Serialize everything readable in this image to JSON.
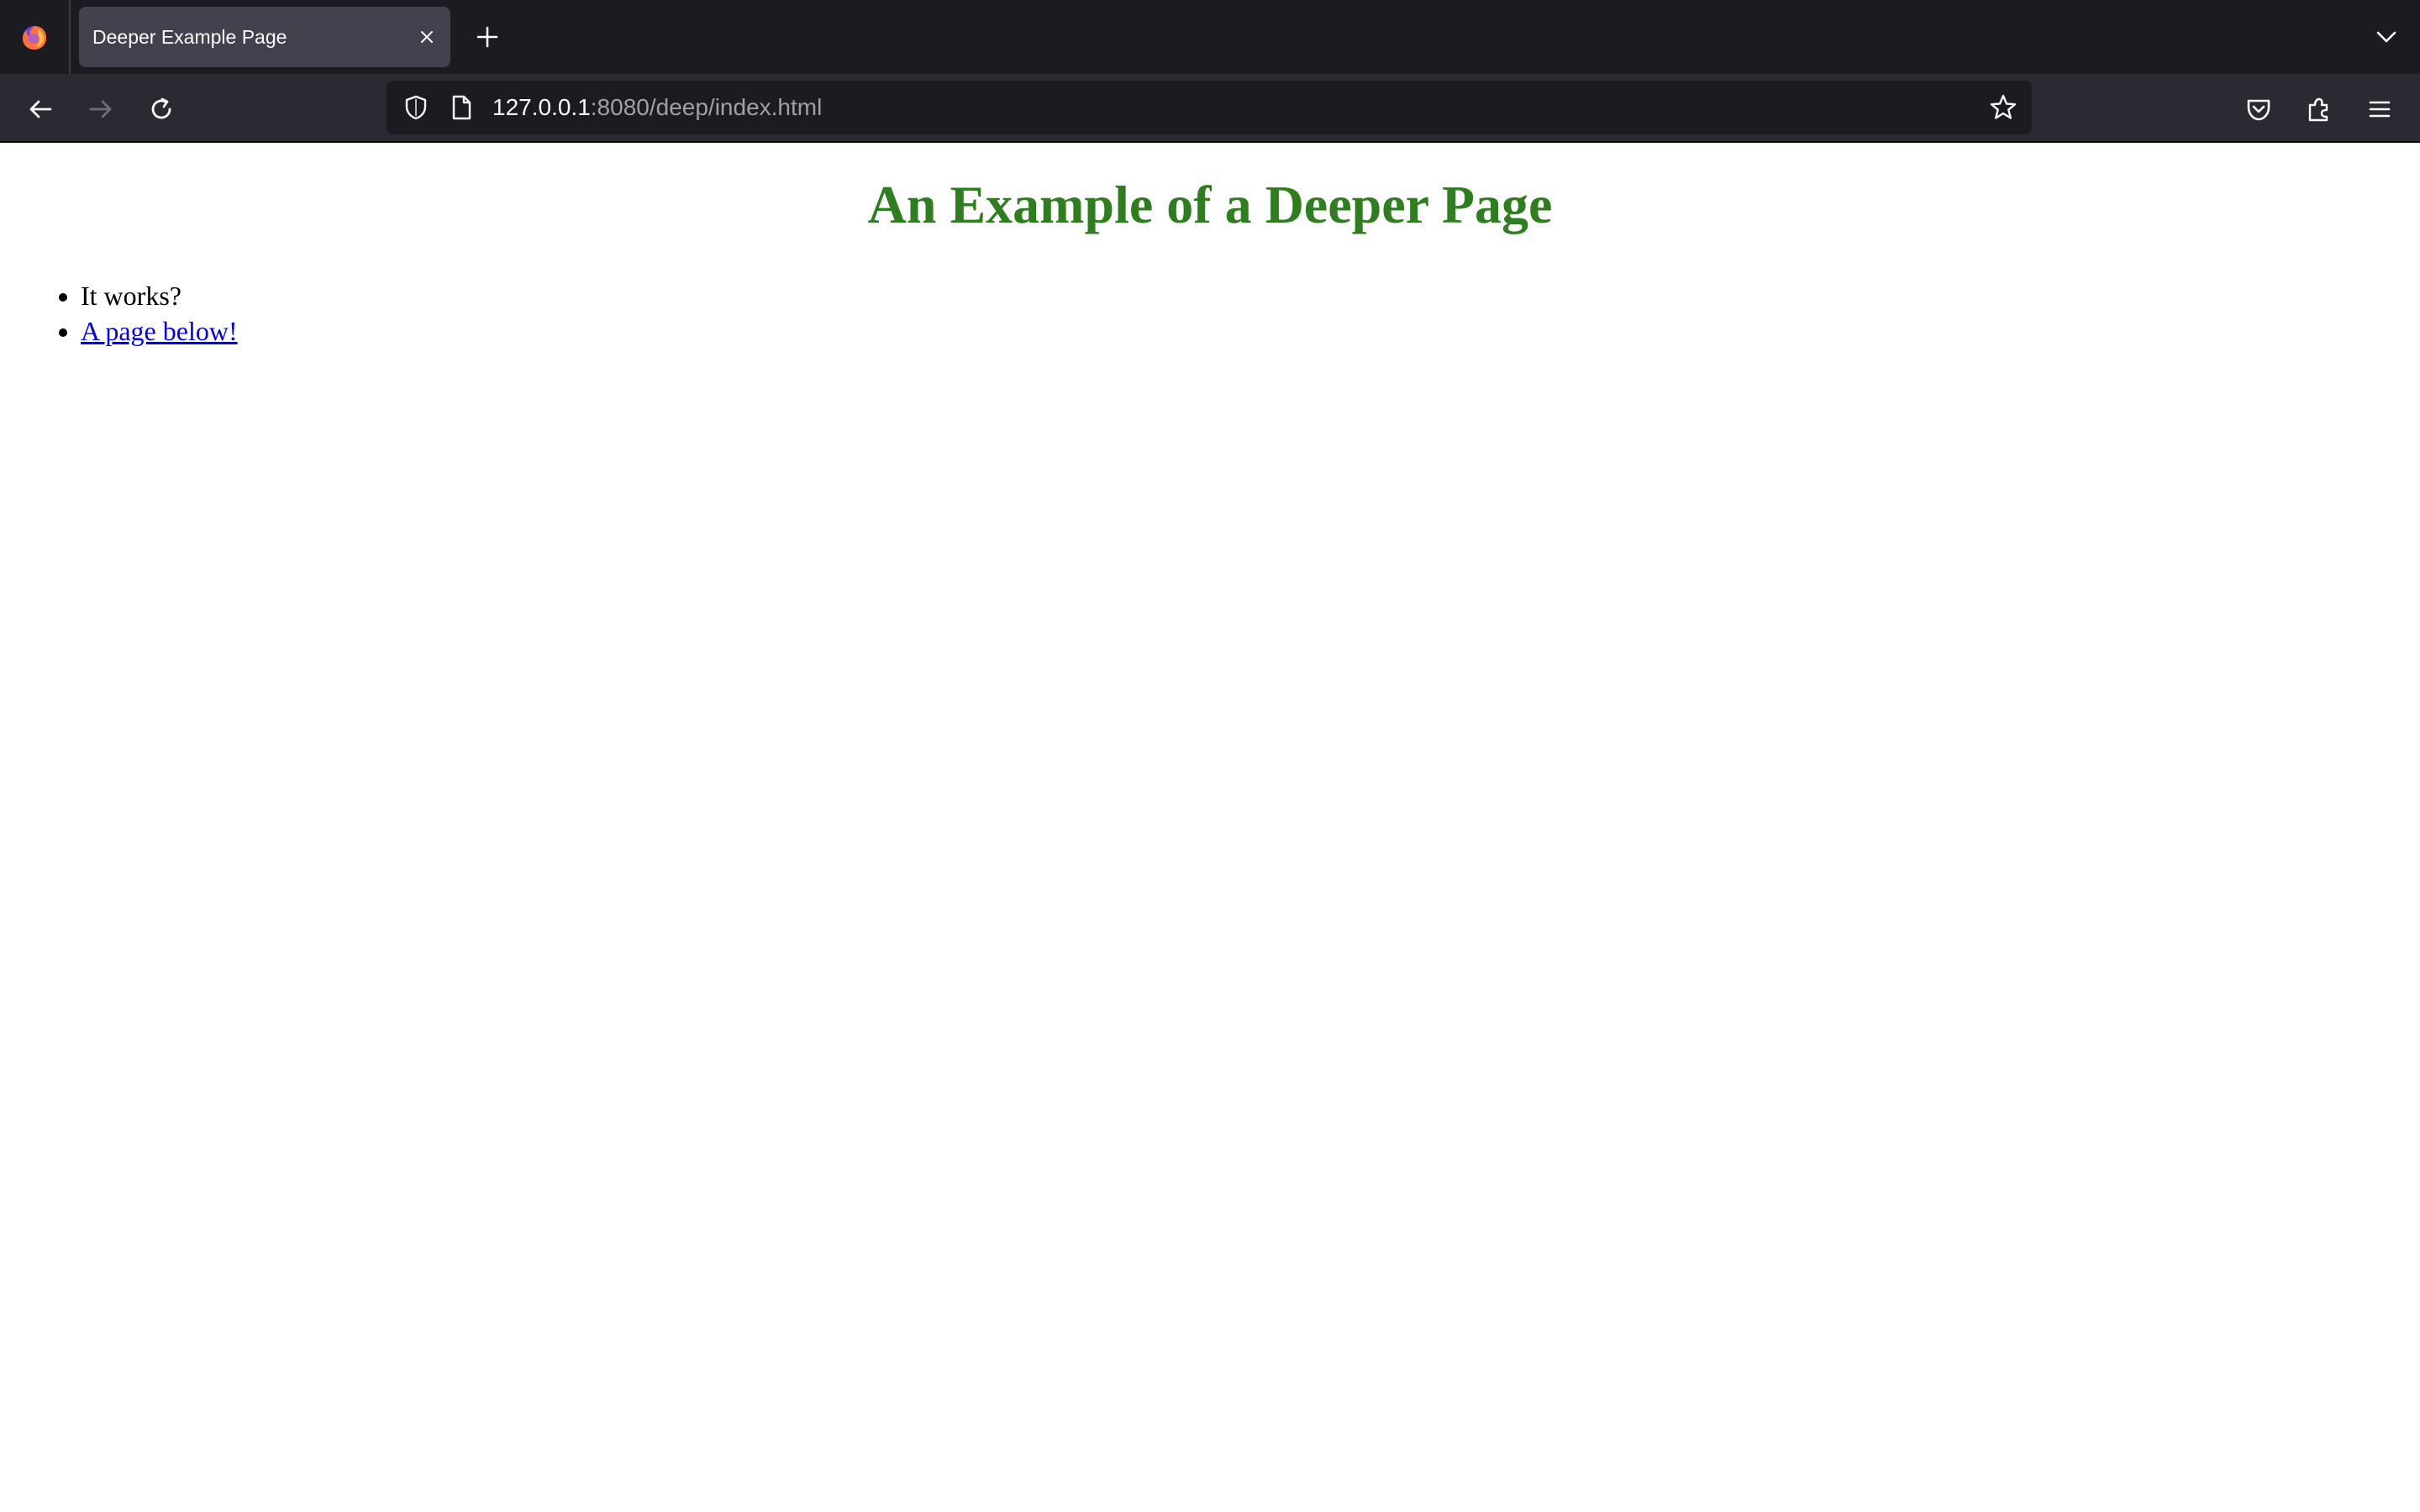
{
  "browser": {
    "tab": {
      "title": "Deeper Example Page"
    },
    "urlbar": {
      "host": "127.0.0.1",
      "rest": ":8080/deep/index.html"
    },
    "icons": {
      "logo": "firefox-logo-icon",
      "tab_close": "close-icon",
      "new_tab": "plus-icon",
      "tab_list": "chevron-down-icon",
      "back": "arrow-left-icon",
      "forward": "arrow-right-icon",
      "reload": "reload-icon",
      "shield": "shield-icon",
      "page": "page-icon",
      "bookmark": "star-icon",
      "pocket": "pocket-icon",
      "extensions": "puzzle-piece-icon",
      "menu": "hamburger-menu-icon"
    },
    "colors": {
      "tabstrip_bg": "#1c1b22",
      "active_tab_bg": "#42414d",
      "navbar_bg": "#2b2a33",
      "urlbar_bg": "#1c1b22",
      "icon": "#fbfbfe",
      "icon_disabled": "#6f6e76"
    }
  },
  "page": {
    "heading": "An Example of a Deeper Page",
    "heading_color": "#2e7d1f",
    "items": [
      {
        "text": "It works?"
      },
      {
        "link_text": "A page below!"
      }
    ],
    "link_color": "#0000ee"
  }
}
